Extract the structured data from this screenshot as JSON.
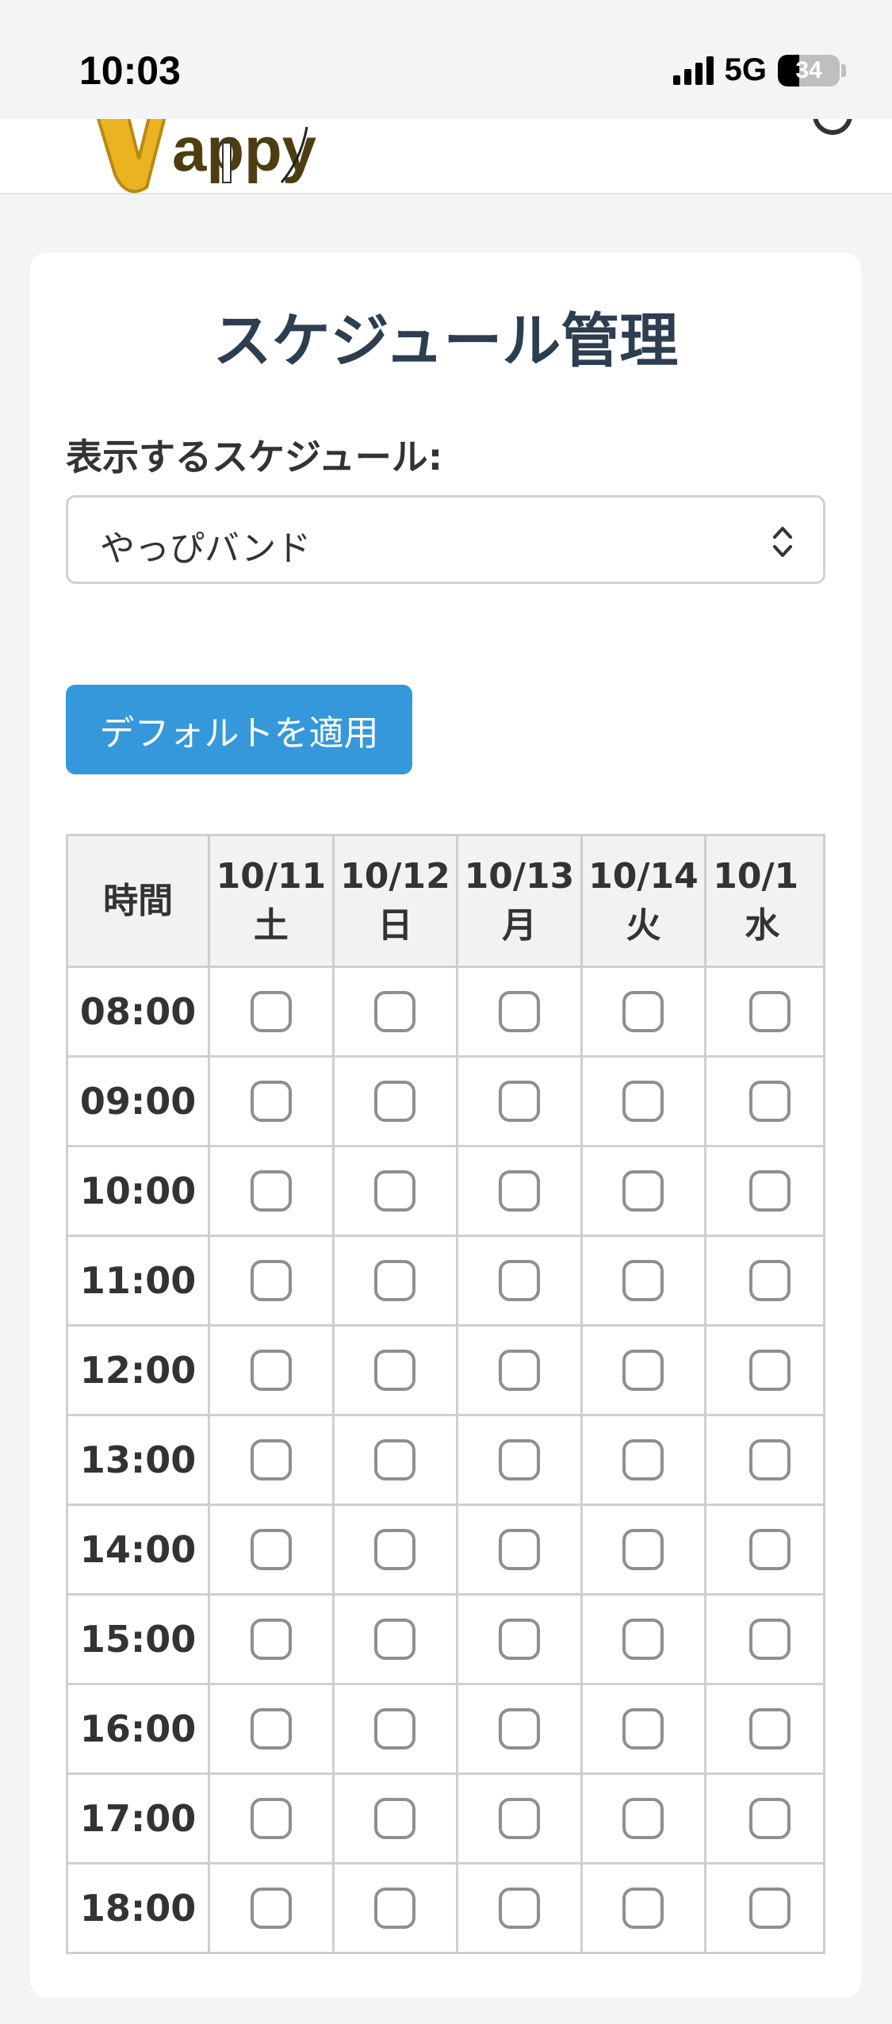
{
  "status_bar": {
    "time": "10:03",
    "network": "5G",
    "battery": "34",
    "battery_level": 0.34
  },
  "header": {
    "logo_text": "Vappy"
  },
  "page": {
    "title": "スケジュール管理",
    "select_label": "表示するスケジュール:",
    "selected_schedule": "やっぴバンド",
    "apply_button": "デフォルトを適用"
  },
  "table": {
    "time_header": "時間",
    "days": [
      {
        "date": "10/11",
        "weekday": "土"
      },
      {
        "date": "10/12",
        "weekday": "日"
      },
      {
        "date": "10/13",
        "weekday": "月"
      },
      {
        "date": "10/14",
        "weekday": "火"
      },
      {
        "date": "10/1",
        "weekday": "水"
      }
    ],
    "times": [
      "08:00",
      "09:00",
      "10:00",
      "11:00",
      "12:00",
      "13:00",
      "14:00",
      "15:00",
      "16:00",
      "17:00",
      "18:00"
    ]
  },
  "colors": {
    "accent": "#3498db",
    "title": "#2c3e50"
  }
}
